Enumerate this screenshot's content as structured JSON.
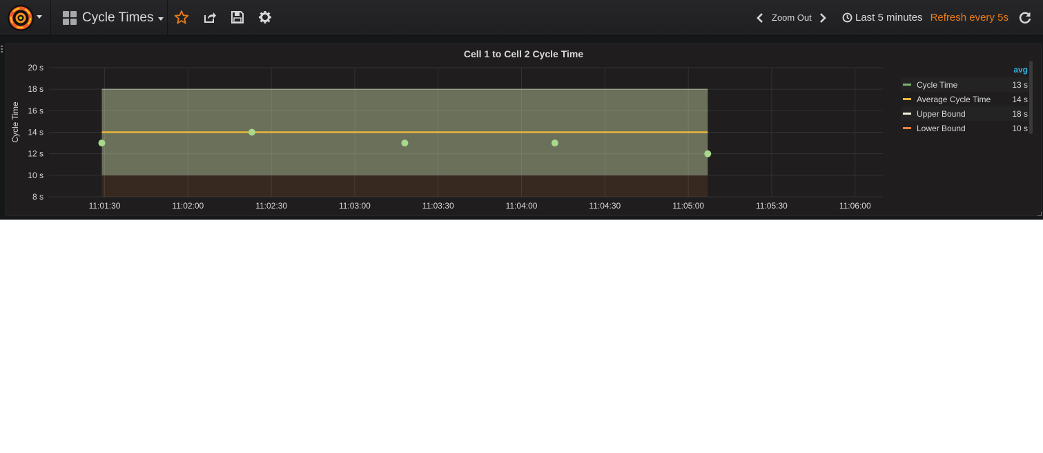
{
  "navbar": {
    "dashboard_title": "Cycle Times",
    "zoom_label": "Zoom Out",
    "time_range": "Last 5 minutes",
    "refresh": "Refresh every 5s"
  },
  "colors": {
    "panel_bg": "#1f1d1d",
    "nav_bg": "#242426",
    "accent_orange": "#eb7b18",
    "legend_header": "#33b5e5",
    "cycle_time": "#7eb26d",
    "average": "#eab839",
    "upper_bound": "#ffffff",
    "lower_bound": "#ef843c"
  },
  "icons": [
    "grafana-logo-icon",
    "dashboard-grid-icon",
    "star-icon",
    "share-icon",
    "save-icon",
    "gear-icon",
    "chevron-left-icon",
    "chevron-right-icon",
    "clock-icon",
    "refresh-icon"
  ],
  "panel": {
    "title": "Cell 1 to Cell 2 Cycle Time",
    "legend_header": "avg",
    "legend": [
      {
        "name": "Cycle Time",
        "value": "13 s",
        "color": "#7eb26d"
      },
      {
        "name": "Average Cycle Time",
        "value": "14 s",
        "color": "#eab839"
      },
      {
        "name": "Upper Bound",
        "value": "18 s",
        "color": "#f4f5dc"
      },
      {
        "name": "Lower Bound",
        "value": "10 s",
        "color": "#ef843c"
      }
    ]
  },
  "chart_data": {
    "type": "line",
    "title": "Cell 1 to Cell 2 Cycle Time",
    "xlabel": "",
    "ylabel": "Cycle Time",
    "ylim": [
      8,
      20
    ],
    "y_ticks": [
      "8 s",
      "10 s",
      "12 s",
      "14 s",
      "16 s",
      "18 s",
      "20 s"
    ],
    "x_ticks": [
      "11:01:30",
      "11:02:00",
      "11:02:30",
      "11:03:00",
      "11:03:30",
      "11:04:00",
      "11:04:30",
      "11:05:00",
      "11:05:30",
      "11:06:00"
    ],
    "xlim": [
      "11:01:10",
      "11:06:10"
    ],
    "grid": true,
    "legend_position": "right",
    "series": [
      {
        "name": "Cycle Time",
        "style": "points",
        "x": [
          "11:01:29",
          "11:02:23",
          "11:03:18",
          "11:04:12",
          "11:05:07"
        ],
        "values": [
          13,
          14,
          13,
          13,
          12
        ]
      },
      {
        "name": "Average Cycle Time",
        "style": "line",
        "x": [
          "11:01:29",
          "11:05:07"
        ],
        "values": [
          14,
          14
        ]
      },
      {
        "name": "Upper Bound",
        "style": "area",
        "x": [
          "11:01:29",
          "11:05:07"
        ],
        "values": [
          18,
          18
        ]
      },
      {
        "name": "Lower Bound",
        "style": "area",
        "x": [
          "11:01:29",
          "11:05:07"
        ],
        "values": [
          10,
          10
        ]
      }
    ]
  }
}
